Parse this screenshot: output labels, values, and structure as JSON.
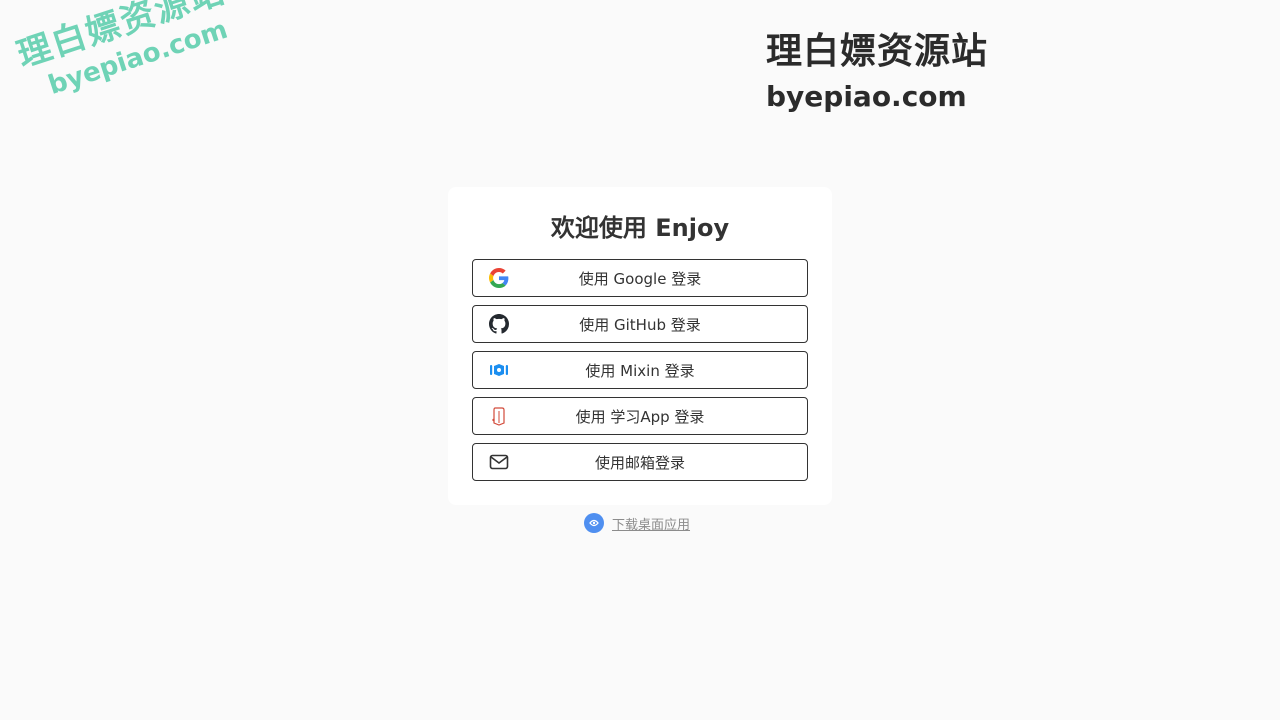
{
  "watermark": {
    "title": "理白嫖资源站",
    "url": "byepiao.com"
  },
  "card": {
    "title": "欢迎使用 Enjoy",
    "buttons": [
      {
        "label": "使用 Google 登录",
        "icon": "google-icon"
      },
      {
        "label": "使用 GitHub 登录",
        "icon": "github-icon"
      },
      {
        "label": "使用 Mixin 登录",
        "icon": "mixin-icon"
      },
      {
        "label": "使用 学习App 登录",
        "icon": "xuexi-app-icon"
      },
      {
        "label": "使用邮箱登录",
        "icon": "mail-icon"
      }
    ]
  },
  "download": {
    "label": "下载桌面应用",
    "icon": "enjoy-logo-icon"
  },
  "colors": {
    "background": "#fafafa",
    "card": "#ffffff",
    "watermark_green": "#6fd3b6",
    "mixin_blue": "#1b8ef0",
    "xuexi_red": "#d24a3a",
    "download_icon_blue": "#4f8ff0"
  }
}
